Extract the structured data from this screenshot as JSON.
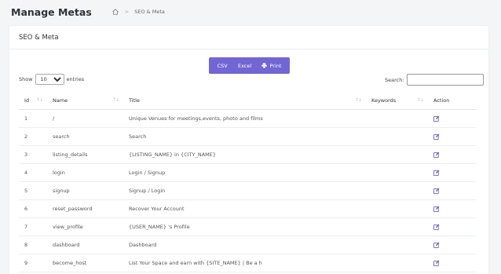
{
  "header": {
    "title": "Manage Metas",
    "breadcrumb_sep": ">",
    "breadcrumb_current": "SEO & Meta"
  },
  "card": {
    "title": "SEO & Meta"
  },
  "export_buttons": {
    "csv": "CSV",
    "excel": "Excel",
    "print": "Print"
  },
  "length_control": {
    "show_label": "Show",
    "selected": "10",
    "entries_label": "entries"
  },
  "search": {
    "label": "Search:",
    "value": ""
  },
  "table": {
    "columns": [
      "Id",
      "Name",
      "Title",
      "Keywords",
      "Action"
    ],
    "rows": [
      {
        "id": "1",
        "name": "/",
        "title": "Unique Venues for meetings,events, photo and films",
        "keywords": ""
      },
      {
        "id": "2",
        "name": "search",
        "title": "Search",
        "keywords": ""
      },
      {
        "id": "3",
        "name": "listing_details",
        "title": "{LISTING_NAME} in {CITY_NAME}",
        "keywords": ""
      },
      {
        "id": "4",
        "name": "login",
        "title": "Login / Signup",
        "keywords": ""
      },
      {
        "id": "5",
        "name": "signup",
        "title": "Signup / Login",
        "keywords": ""
      },
      {
        "id": "6",
        "name": "reset_password",
        "title": "Recover Your Account",
        "keywords": ""
      },
      {
        "id": "7",
        "name": "view_profile",
        "title": "{USER_NAME} 's Profile",
        "keywords": ""
      },
      {
        "id": "8",
        "name": "dashboard",
        "title": "Dashboard",
        "keywords": ""
      },
      {
        "id": "9",
        "name": "become_host",
        "title": "List Your Space and earn with {SITE_NAME} | Be a h",
        "keywords": ""
      }
    ]
  },
  "icons": {
    "home": "home-icon",
    "print": "print-icon",
    "edit": "edit-icon",
    "sort": "sort-icon"
  },
  "colors": {
    "accent": "#7266d4",
    "background": "#f4f5f7"
  }
}
